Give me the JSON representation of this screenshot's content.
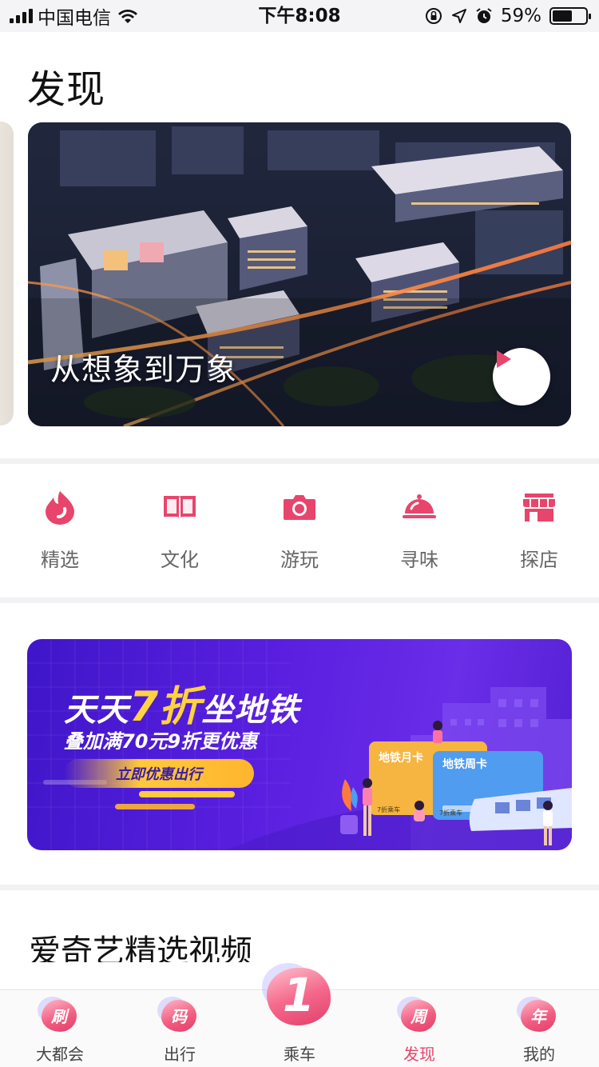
{
  "status_bar": {
    "carrier": "中国电信",
    "time": "下午8:08",
    "battery": "59%",
    "battery_level": 0.59,
    "icons": [
      "signal-icon",
      "wifi-icon",
      "orientation-lock-icon",
      "location-icon",
      "alarm-icon",
      "battery-icon"
    ]
  },
  "page": {
    "title": "发现"
  },
  "hero": {
    "caption": "从想象到万象",
    "play_icon": "play-icon"
  },
  "categories": [
    {
      "label": "精选",
      "icon": "flame-icon"
    },
    {
      "label": "文化",
      "icon": "book-icon"
    },
    {
      "label": "游玩",
      "icon": "camera-icon"
    },
    {
      "label": "寻味",
      "icon": "food-cloche-icon"
    },
    {
      "label": "探店",
      "icon": "store-icon"
    }
  ],
  "promo": {
    "headline_pre": "天天",
    "headline_accent": "7折",
    "headline_post": "坐地铁",
    "subline": "叠加满70元9折更优惠",
    "cta": "立即优惠出行",
    "card_monthly": "地铁月卡",
    "card_weekly": "地铁周卡",
    "card_note_1": "7折乘车",
    "card_note_2": "7折乘车"
  },
  "section": {
    "title": "爱奇艺精选视频"
  },
  "tabbar": {
    "tabs": [
      {
        "label": "大都会",
        "badge": "刷"
      },
      {
        "label": "出行",
        "badge": "码"
      },
      {
        "label": "乘车",
        "badge": "1"
      },
      {
        "label": "发现",
        "badge": "周"
      },
      {
        "label": "我的",
        "badge": "年"
      }
    ],
    "active_index": 3,
    "active_color": "#e8456c"
  },
  "colors": {
    "accent": "#e8456c",
    "promo_bg": "#5a1fe0",
    "promo_highlight": "#ffd23f"
  }
}
